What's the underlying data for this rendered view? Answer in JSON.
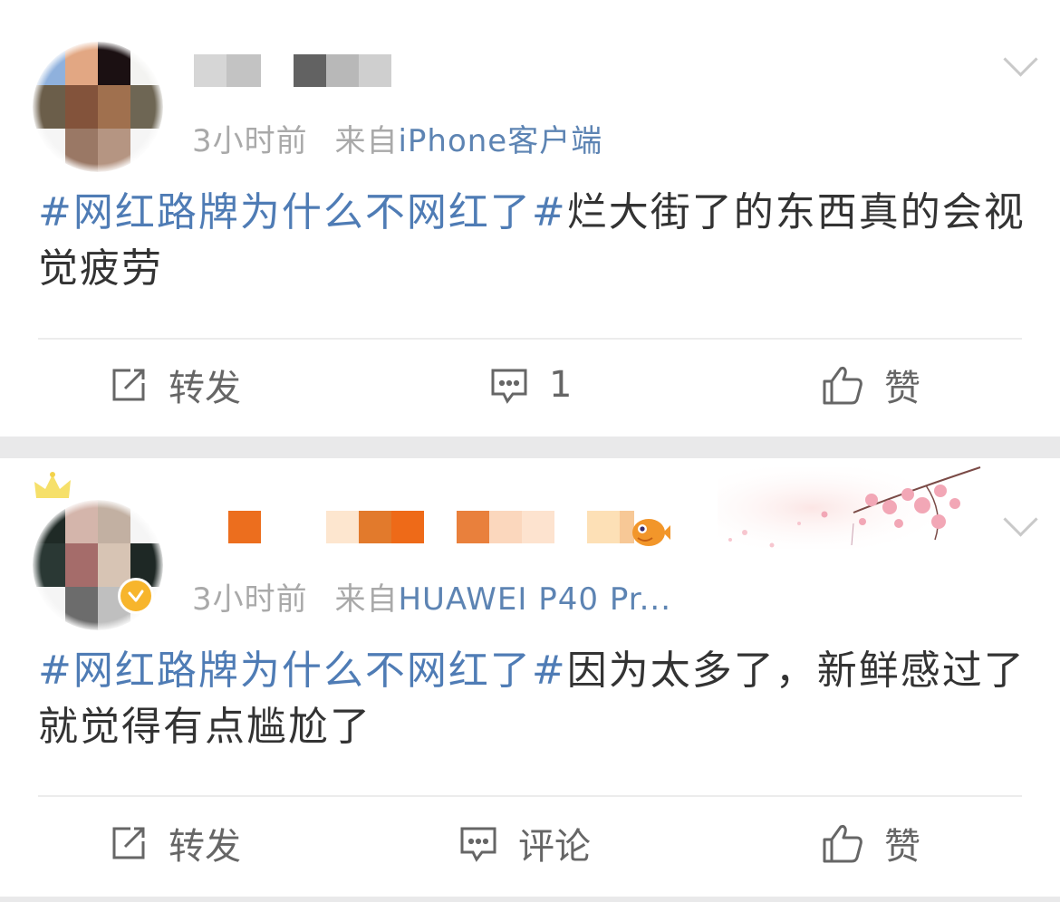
{
  "posts": [
    {
      "time": "3小时前",
      "source_prefix": "来自",
      "source": "iPhone客户端",
      "hashtag": "#网红路牌为什么不网红了#",
      "text": "烂大街了的东西真的会视觉疲劳",
      "actions": {
        "repost": "转发",
        "comment": "1",
        "like": "赞"
      }
    },
    {
      "time": "3小时前",
      "source_prefix": "来自",
      "source": "HUAWEI P40 Pr...",
      "hashtag": "#网红路牌为什么不网红了#",
      "text": "因为太多了，新鲜感过了就觉得有点尴尬了",
      "actions": {
        "repost": "转发",
        "comment": "评论",
        "like": "赞"
      }
    }
  ],
  "icons": {
    "menu": "chevron-down-icon",
    "repost": "share-edit-icon",
    "comment": "comment-bubble-icon",
    "like": "thumbs-up-icon",
    "verified": "verified-badge-icon"
  },
  "colors": {
    "link": "#4f7cb5",
    "source": "#5d84b3",
    "meta": "#a9a9a9",
    "text": "#333333",
    "verified": "#f7b52c"
  }
}
